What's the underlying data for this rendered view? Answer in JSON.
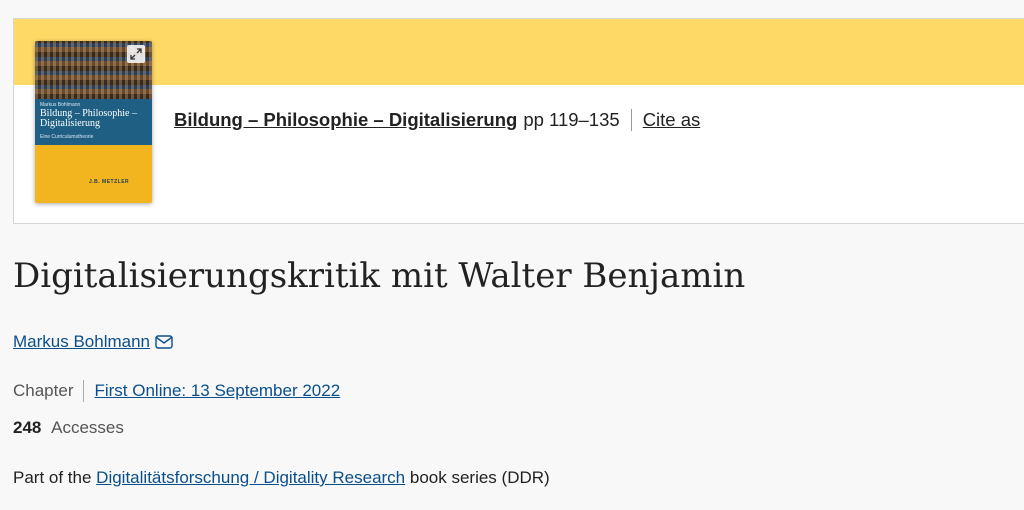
{
  "book": {
    "title": "Bildung – Philosophie – Digitalisierung",
    "pages": "pp 119–135",
    "cite_label": "Cite as",
    "cover": {
      "author": "Markus Bohlmann",
      "title": "Bildung – Philosophie – Digitalisierung",
      "subtitle": "Eine Curriculumstheorie",
      "publisher": "J.B. METZLER",
      "expand_icon": "expand-icon"
    }
  },
  "chapter": {
    "title": "Digitalisierungskritik mit Walter Benjamin",
    "author": "Markus Bohlmann",
    "author_icon": "mail-icon",
    "type": "Chapter",
    "first_online": "First Online: 13 September 2022",
    "accesses_count": "248",
    "accesses_label": "Accesses",
    "series_prefix": "Part of the",
    "series_name": "Digitalitätsforschung / Digitality Research",
    "series_suffix": "book series (DDR)"
  },
  "colors": {
    "band": "#ffd966",
    "link": "#0a4f8c",
    "cover_yellow": "#f2b51f",
    "cover_blue": "#1f5f84"
  }
}
